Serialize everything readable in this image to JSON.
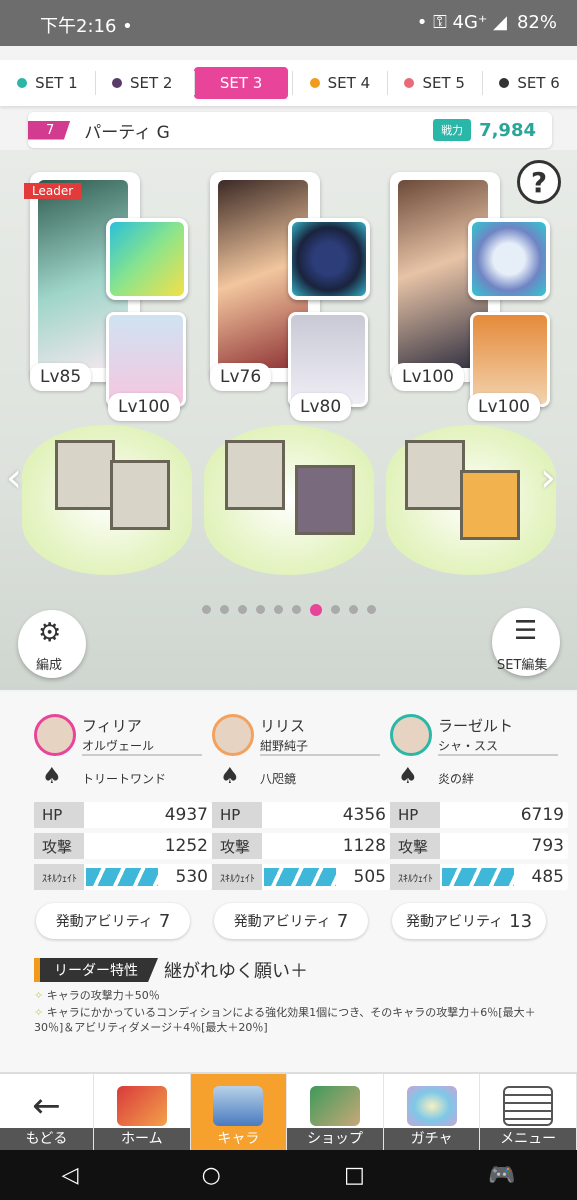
{
  "status": {
    "time": "下午2:16 •",
    "indicators": "• ⚿ 4G⁺ ◢",
    "battery": "82%"
  },
  "tabs": [
    {
      "label": "SET 1",
      "color": "#2bb7a8"
    },
    {
      "label": "SET 2",
      "color": "#5a3a6b"
    },
    {
      "label": "SET 3",
      "color": "#ffffff"
    },
    {
      "label": "SET 4",
      "color": "#f29a1c"
    },
    {
      "label": "SET 5",
      "color": "#ea6a7a"
    },
    {
      "label": "SET 6",
      "color": "#333333"
    }
  ],
  "party": {
    "number": "7",
    "name": "パーティ G",
    "power_label": "戦力",
    "power": "7,984"
  },
  "help": "?",
  "leader_tag": "Leader",
  "slots": [
    {
      "main_lv": "Lv85",
      "sub_lv": "Lv100"
    },
    {
      "main_lv": "Lv76",
      "sub_lv": "Lv80"
    },
    {
      "main_lv": "Lv100",
      "sub_lv": "Lv100"
    }
  ],
  "page_dots": {
    "count": 9,
    "active": 6
  },
  "buttons": {
    "formation": "編成",
    "set_edit": "SET編集"
  },
  "chars": [
    {
      "name": "フィリア",
      "sub": "オルヴェール",
      "weapon": "トリートワンド",
      "hp": "4937",
      "atk": "1252",
      "wait": "530",
      "ability": "7"
    },
    {
      "name": "リリス",
      "sub": "紺野純子",
      "weapon": "八咫鏡",
      "hp": "4356",
      "atk": "1128",
      "wait": "505",
      "ability": "7"
    },
    {
      "name": "ラーゼルト",
      "sub": "シャ・スス",
      "weapon": "炎の絆",
      "hp": "6719",
      "atk": "793",
      "wait": "485",
      "ability": "13"
    }
  ],
  "stat_labels": {
    "hp": "HP",
    "atk": "攻撃",
    "wait": "ｽｷﾙｳｪｲﾄ",
    "ability": "発動アビリティ"
  },
  "leader": {
    "label": "リーダー特性",
    "name": "継がれゆく願い＋",
    "effects": [
      "キャラの攻撃力＋50％",
      "キャラにかかっているコンディションによる強化効果1個につき、そのキャラの攻撃力＋6％[最大＋30％]＆アビリティダメージ＋4％[最大＋20％]"
    ]
  },
  "nav": [
    {
      "label": "もどる"
    },
    {
      "label": "ホーム"
    },
    {
      "label": "キャラ"
    },
    {
      "label": "ショップ"
    },
    {
      "label": "ガチャ"
    },
    {
      "label": "メニュー"
    }
  ]
}
